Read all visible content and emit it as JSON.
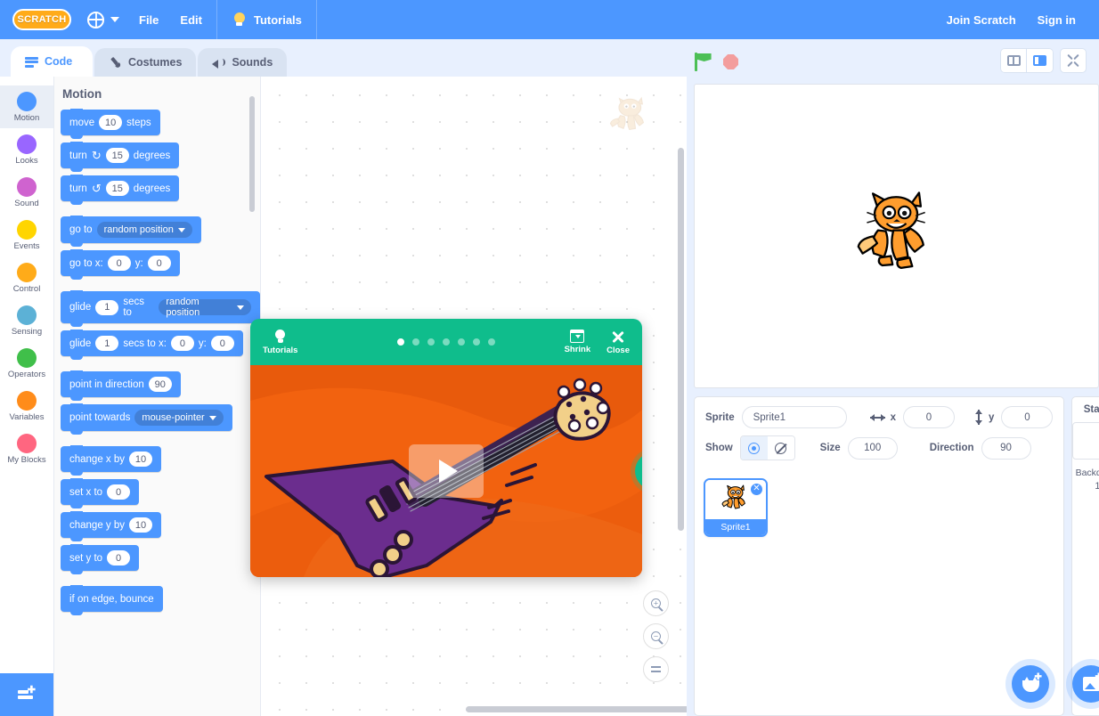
{
  "menubar": {
    "logo_text": "SCRATCH",
    "globe_icon": "globe-icon",
    "items": [
      {
        "label": "File",
        "name": "menu-file"
      },
      {
        "label": "Edit",
        "name": "menu-edit"
      }
    ],
    "tutorials_label": "Tutorials",
    "join_label": "Join Scratch",
    "signin_label": "Sign in"
  },
  "tabs": [
    {
      "label": "Code",
      "icon": "code-icon",
      "active": true
    },
    {
      "label": "Costumes",
      "icon": "paintbrush-icon",
      "active": false
    },
    {
      "label": "Sounds",
      "icon": "speaker-icon",
      "active": false
    }
  ],
  "run_controls": {
    "green_flag": "green-flag-icon",
    "stop": "stop-icon",
    "flag_color": "#4cbf56",
    "stop_color": "#f39d9d"
  },
  "stage_size_controls": [
    {
      "name": "small-stage-button",
      "icon": "small-stage-icon",
      "selected": false
    },
    {
      "name": "large-stage-button",
      "icon": "large-stage-icon",
      "selected": true
    },
    {
      "name": "fullscreen-button",
      "icon": "fullscreen-icon",
      "selected": false
    }
  ],
  "categories": [
    {
      "label": "Motion",
      "color": "#4c97ff",
      "active": true
    },
    {
      "label": "Looks",
      "color": "#9966ff",
      "active": false
    },
    {
      "label": "Sound",
      "color": "#cf63cf",
      "active": false
    },
    {
      "label": "Events",
      "color": "#ffd500",
      "active": false
    },
    {
      "label": "Control",
      "color": "#ffab19",
      "active": false
    },
    {
      "label": "Sensing",
      "color": "#5cb1d6",
      "active": false
    },
    {
      "label": "Operators",
      "color": "#40bf4a",
      "active": false
    },
    {
      "label": "Variables",
      "color": "#ff8c1a",
      "active": false
    },
    {
      "label": "My Blocks",
      "color": "#ff6680",
      "active": false
    }
  ],
  "palette": {
    "heading": "Motion",
    "add_extension_label": "add-extension",
    "blocks": [
      {
        "parts": [
          {
            "t": "text",
            "v": "move"
          },
          {
            "t": "num",
            "v": "10"
          },
          {
            "t": "text",
            "v": "steps"
          }
        ]
      },
      {
        "parts": [
          {
            "t": "text",
            "v": "turn"
          },
          {
            "t": "rot",
            "v": "↻"
          },
          {
            "t": "num",
            "v": "15"
          },
          {
            "t": "text",
            "v": "degrees"
          }
        ]
      },
      {
        "parts": [
          {
            "t": "text",
            "v": "turn"
          },
          {
            "t": "rot",
            "v": "↺"
          },
          {
            "t": "num",
            "v": "15"
          },
          {
            "t": "text",
            "v": "degrees"
          }
        ]
      },
      {
        "gap": true
      },
      {
        "parts": [
          {
            "t": "text",
            "v": "go to"
          },
          {
            "t": "drop",
            "v": "random position"
          }
        ]
      },
      {
        "parts": [
          {
            "t": "text",
            "v": "go to x:"
          },
          {
            "t": "num",
            "v": "0"
          },
          {
            "t": "text",
            "v": "y:"
          },
          {
            "t": "num",
            "v": "0"
          }
        ]
      },
      {
        "gap": true
      },
      {
        "parts": [
          {
            "t": "text",
            "v": "glide"
          },
          {
            "t": "num",
            "v": "1"
          },
          {
            "t": "text",
            "v": "secs to"
          },
          {
            "t": "drop",
            "v": "random position"
          }
        ]
      },
      {
        "parts": [
          {
            "t": "text",
            "v": "glide"
          },
          {
            "t": "num",
            "v": "1"
          },
          {
            "t": "text",
            "v": "secs to x:"
          },
          {
            "t": "num",
            "v": "0"
          },
          {
            "t": "text",
            "v": "y:"
          },
          {
            "t": "num",
            "v": "0"
          }
        ]
      },
      {
        "gap": true
      },
      {
        "parts": [
          {
            "t": "text",
            "v": "point in direction"
          },
          {
            "t": "num",
            "v": "90"
          }
        ]
      },
      {
        "parts": [
          {
            "t": "text",
            "v": "point towards"
          },
          {
            "t": "drop",
            "v": "mouse-pointer"
          }
        ]
      },
      {
        "gap": true
      },
      {
        "parts": [
          {
            "t": "text",
            "v": "change x by"
          },
          {
            "t": "num",
            "v": "10"
          }
        ]
      },
      {
        "parts": [
          {
            "t": "text",
            "v": "set x to"
          },
          {
            "t": "num",
            "v": "0"
          }
        ]
      },
      {
        "parts": [
          {
            "t": "text",
            "v": "change y by"
          },
          {
            "t": "num",
            "v": "10"
          }
        ]
      },
      {
        "parts": [
          {
            "t": "text",
            "v": "set y to"
          },
          {
            "t": "num",
            "v": "0"
          }
        ]
      },
      {
        "gap": true
      },
      {
        "parts": [
          {
            "t": "text",
            "v": "if on edge, bounce"
          }
        ]
      }
    ]
  },
  "canvas": {
    "watermark_icon": "scratch-cat-watermark",
    "zoom_in": "zoom-in-icon",
    "zoom_out": "zoom-out-icon",
    "zoom_reset": "zoom-reset-icon"
  },
  "tutorial": {
    "brand_label": "Tutorials",
    "shrink_label": "Shrink",
    "close_label": "Close",
    "dot_count": 7,
    "active_dot": 0,
    "header_color": "#0fbd8c",
    "video_bg_color": "#f2620f",
    "video_subject": "purple-electric-guitar",
    "play_icon": "play-icon",
    "next_icon": "next-arrow-icon"
  },
  "stage": {
    "sprite_visual": "scratch-cat"
  },
  "sprite_info": {
    "sprite_label": "Sprite",
    "sprite_name": "Sprite1",
    "sprite_name_placeholder": "Sprite1",
    "x_label": "x",
    "x_value": "0",
    "y_label": "y",
    "y_value": "0",
    "show_label": "Show",
    "show_visible": true,
    "size_label": "Size",
    "size_value": "100",
    "direction_label": "Direction",
    "direction_value": "90"
  },
  "sprites": [
    {
      "name": "Sprite1",
      "selected": true,
      "delete_icon": "close-icon",
      "thumb": "scratch-cat"
    }
  ],
  "stage_pane": {
    "title": "Stage",
    "backdrops_label": "Backdrops",
    "backdrops_count": "1"
  },
  "fabs": {
    "choose_sprite": "choose-sprite-icon",
    "choose_backdrop": "choose-backdrop-icon"
  }
}
